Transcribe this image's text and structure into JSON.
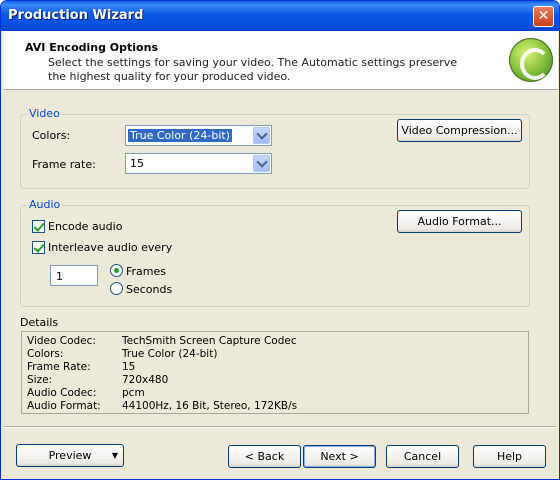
{
  "window": {
    "title": "Production Wizard",
    "close_glyph": "✕"
  },
  "header": {
    "title": "AVI Encoding Options",
    "description": "Select the settings for saving your video.  The Automatic settings preserve the highest quality for your produced video."
  },
  "video": {
    "group_label": "Video",
    "colors_label": "Colors:",
    "colors_value": "True Color (24-bit)",
    "framerate_label": "Frame rate:",
    "framerate_value": "15",
    "compression_button": "Video Compression..."
  },
  "audio": {
    "group_label": "Audio",
    "encode_label": "Encode audio",
    "encode_checked": true,
    "interleave_label": "Interleave audio every",
    "interleave_checked": true,
    "interleave_value": "1",
    "frames_label": "Frames",
    "seconds_label": "Seconds",
    "selected_unit": "Frames",
    "format_button": "Audio Format..."
  },
  "details": {
    "label": "Details",
    "rows": [
      {
        "key": "Video Codec:",
        "value": "TechSmith Screen Capture Codec"
      },
      {
        "key": "Colors:",
        "value": "True Color (24-bit)"
      },
      {
        "key": "Frame Rate:",
        "value": "15"
      },
      {
        "key": "Size:",
        "value": "720x480"
      },
      {
        "key": "Audio Codec:",
        "value": "pcm"
      },
      {
        "key": "Audio Format:",
        "value": "44100Hz, 16 Bit, Stereo, 172KB/s"
      }
    ]
  },
  "footer": {
    "preview": "Preview",
    "back": "< Back",
    "next": "Next >",
    "cancel": "Cancel",
    "help": "Help"
  },
  "colors": {
    "titlebar": "#0b58e4",
    "accent": "#0046d5",
    "window_bg": "#ece9d8"
  }
}
